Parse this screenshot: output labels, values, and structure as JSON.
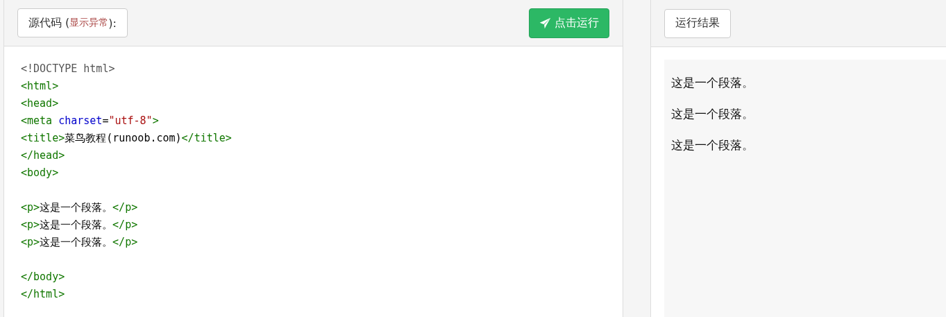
{
  "source_panel": {
    "title": {
      "prefix": "源代码 (",
      "note": "显示异常",
      "suffix": "):"
    },
    "run_button": {
      "label": "点击运行"
    },
    "code_lines": [
      {
        "kind": "code",
        "tokens": [
          {
            "kind": "doctype",
            "text": "<!DOCTYPE html>"
          }
        ]
      },
      {
        "kind": "code",
        "tokens": [
          {
            "kind": "tag",
            "text": "<html>"
          }
        ]
      },
      {
        "kind": "code",
        "tokens": [
          {
            "kind": "tag",
            "text": "<head>"
          }
        ]
      },
      {
        "kind": "code",
        "tokens": [
          {
            "kind": "tag",
            "text": "<meta "
          },
          {
            "kind": "attr",
            "text": "charset"
          },
          {
            "kind": "text",
            "text": "="
          },
          {
            "kind": "value",
            "text": "\"utf-8\""
          },
          {
            "kind": "tag",
            "text": ">"
          }
        ]
      },
      {
        "kind": "code",
        "tokens": [
          {
            "kind": "tag",
            "text": "<title>"
          },
          {
            "kind": "text",
            "text": "菜鸟教程(runoob.com)"
          },
          {
            "kind": "tag",
            "text": "</title>"
          }
        ]
      },
      {
        "kind": "code",
        "tokens": [
          {
            "kind": "tag",
            "text": "</head>"
          }
        ]
      },
      {
        "kind": "code",
        "tokens": [
          {
            "kind": "tag",
            "text": "<body>"
          }
        ]
      },
      {
        "kind": "blank"
      },
      {
        "kind": "code",
        "tokens": [
          {
            "kind": "tag",
            "text": "<p>"
          },
          {
            "kind": "text",
            "text": "这是一个段落。"
          },
          {
            "kind": "tag",
            "text": "</p>"
          }
        ]
      },
      {
        "kind": "code",
        "tokens": [
          {
            "kind": "tag",
            "text": "<p>"
          },
          {
            "kind": "text",
            "text": "这是一个段落。"
          },
          {
            "kind": "tag",
            "text": "</p>"
          }
        ]
      },
      {
        "kind": "code",
        "tokens": [
          {
            "kind": "tag",
            "text": "<p>"
          },
          {
            "kind": "text",
            "text": "这是一个段落。"
          },
          {
            "kind": "tag",
            "text": "</p>"
          }
        ]
      },
      {
        "kind": "blank"
      },
      {
        "kind": "code",
        "tokens": [
          {
            "kind": "tag",
            "text": "</body>"
          }
        ]
      },
      {
        "kind": "code",
        "tokens": [
          {
            "kind": "tag",
            "text": "</html>"
          }
        ]
      }
    ]
  },
  "result_panel": {
    "title": "运行结果",
    "paragraphs": [
      "这是一个段落。",
      "这是一个段落。",
      "这是一个段落。"
    ]
  }
}
